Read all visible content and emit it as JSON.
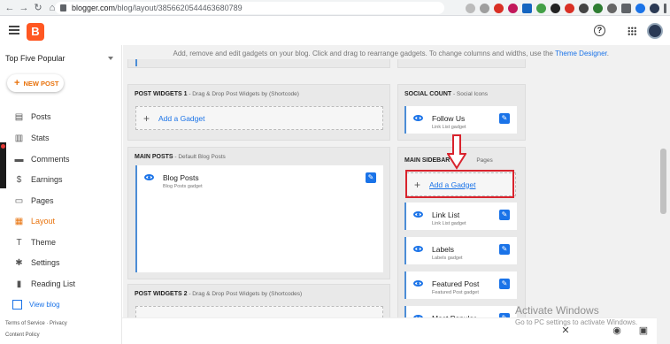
{
  "browser": {
    "url_host": "blogger.com",
    "url_path": "/blog/layout/3856620544463680789"
  },
  "header": {
    "logo_letter": "B",
    "help_icon": "?"
  },
  "sidebar": {
    "blog_name": "Top Five Popular",
    "new_post_label": "NEW POST",
    "items": [
      {
        "label": "Posts",
        "icon": "posts-icon"
      },
      {
        "label": "Stats",
        "icon": "stats-icon"
      },
      {
        "label": "Comments",
        "icon": "comments-icon"
      },
      {
        "label": "Earnings",
        "icon": "earnings-icon"
      },
      {
        "label": "Pages",
        "icon": "pages-icon"
      },
      {
        "label": "Layout",
        "icon": "layout-icon",
        "active": true
      },
      {
        "label": "Theme",
        "icon": "theme-icon"
      },
      {
        "label": "Settings",
        "icon": "settings-icon"
      },
      {
        "label": "Reading List",
        "icon": "reading-list-icon"
      }
    ],
    "view_blog": "View blog",
    "footer_terms": "Terms of Service",
    "footer_separator": "·",
    "footer_privacy": "Privacy",
    "footer_content_policy": "Content Policy"
  },
  "main": {
    "intro_text": "Add, remove and edit gadgets on your blog. Click and drag to rearrange gadgets. To change columns and widths, use the",
    "intro_link": "Theme Designer",
    "intro_end": ".",
    "post_widgets_1": {
      "title": "POST WIDGETS 1",
      "subtitle": " - Drag & Drop Post Widgets by (Shortcode)",
      "add_label": "Add a Gadget"
    },
    "main_posts": {
      "title": "MAIN POSTS",
      "subtitle": " - Default Blog Posts",
      "gadget_name": "Blog Posts",
      "gadget_sub": "Blog Posts gadget"
    },
    "post_widgets_2": {
      "title": "POST WIDGETS 2",
      "subtitle": " - Drag & Drop Post Widgets by (Shortcodes)"
    },
    "social_count": {
      "title": "SOCIAL COUNT",
      "subtitle": " - Social Icons",
      "gadget_name": "Follow Us",
      "gadget_sub": "Link List gadget"
    },
    "main_sidebar": {
      "title": "MAIN SIDEBAR",
      "subtitle": "Pages",
      "add_label": "Add a Gadget",
      "gadgets": [
        {
          "name": "Link List",
          "sub": "Link List gadget"
        },
        {
          "name": "Labels",
          "sub": "Labels gadget"
        },
        {
          "name": "Featured Post",
          "sub": "Featured Post gadget"
        },
        {
          "name": "Most Popular",
          "sub": ""
        }
      ]
    }
  },
  "watermark": {
    "title": "Activate Windows",
    "subtitle": "Go to PC settings to activate Windows."
  },
  "colors": {
    "accent": "#e8710a",
    "link": "#1a73e8",
    "highlight": "#d9232d"
  }
}
